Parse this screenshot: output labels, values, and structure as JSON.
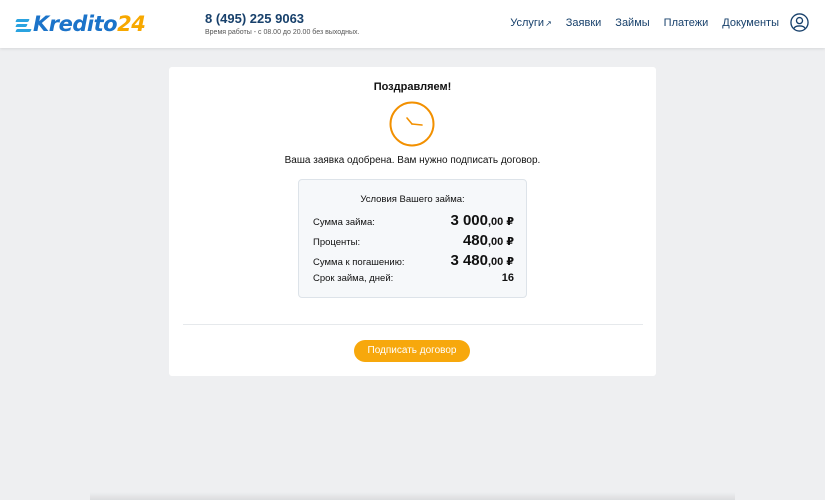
{
  "header": {
    "logo": {
      "part1": "Kredito",
      "part2": "24"
    },
    "phone": "8 (495) 225 9063",
    "hours": "Время работы - с 08.00 до 20.00 без выходных.",
    "nav": [
      {
        "label": "Услуги"
      },
      {
        "label": "Заявки"
      },
      {
        "label": "Займы"
      },
      {
        "label": "Платежи"
      },
      {
        "label": "Документы"
      }
    ]
  },
  "card": {
    "title": "Поздравляем!",
    "message": "Ваша заявка одобрена. Вам нужно подписать договор.",
    "terms": {
      "title": "Условия Вашего займа:",
      "rows": [
        {
          "label": "Сумма займа:",
          "int": "3 000",
          "dec": ",00 ₽"
        },
        {
          "label": "Проценты:",
          "int": "480",
          "dec": ",00 ₽"
        },
        {
          "label": "Сумма к погашению:",
          "int": "3 480",
          "dec": ",00 ₽"
        },
        {
          "label": "Срок займа, дней:",
          "value": "16"
        }
      ]
    },
    "button": "Подписать договор"
  },
  "colors": {
    "accent": "#f7a80c",
    "brand_blue": "#1b73c9",
    "nav_text": "#17406b",
    "background": "#eeeff1"
  }
}
